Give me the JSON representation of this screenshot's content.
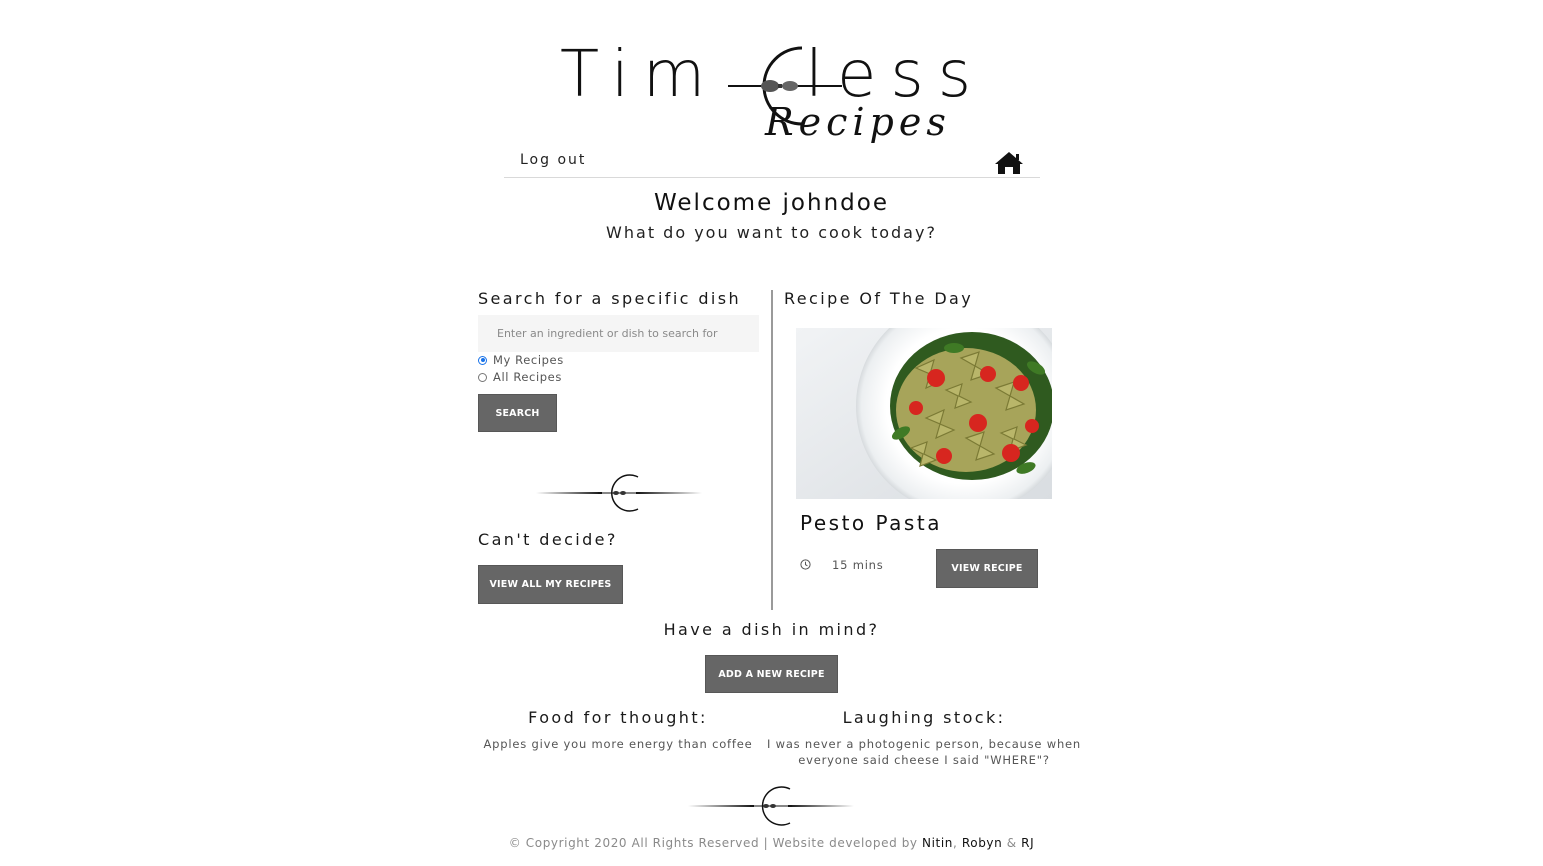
{
  "brand": {
    "title": "Tim",
    "title_end": "less",
    "subtitle": "Recipes"
  },
  "nav": {
    "logout_label": "Log out",
    "home_icon": "home-icon"
  },
  "welcome": {
    "heading": "Welcome johndoe",
    "tagline": "What do you want to cook today?"
  },
  "search": {
    "heading": "Search for a specific dish",
    "placeholder": "Enter an ingredient or dish to search for",
    "value": "",
    "options": [
      {
        "label": "My Recipes",
        "selected": true
      },
      {
        "label": "All Recipes",
        "selected": false
      }
    ],
    "button_label": "Search"
  },
  "undecided": {
    "heading": "Can't decide?",
    "button_label": "View all my recipes"
  },
  "recipe_of_day": {
    "heading": "Recipe Of The Day",
    "title": "Pesto Pasta",
    "time": "15 mins",
    "time_icon": "clock-icon",
    "button_label": "View recipe"
  },
  "add_dish": {
    "heading": "Have a dish in mind?",
    "button_label": "Add a new recipe"
  },
  "food_for_thought": {
    "heading": "Food for thought:",
    "text": "Apples give you more energy than coffee"
  },
  "laughing_stock": {
    "heading": "Laughing stock:",
    "line1": "I was never a photogenic person, because when",
    "line2": "everyone said cheese I said \"WHERE\"?"
  },
  "footer": {
    "prefix": "© Copyright 2020 All Rights Reserved | Website developed by",
    "dev1": "Nitin",
    "sep1": ",",
    "dev2": "Robyn",
    "sep2": "&",
    "dev3": "RJ"
  },
  "colors": {
    "button_bg": "#666666",
    "accent_radio": "#1a73e8",
    "divider": "#9a9a9a",
    "input_bg": "#f5f5f5"
  }
}
